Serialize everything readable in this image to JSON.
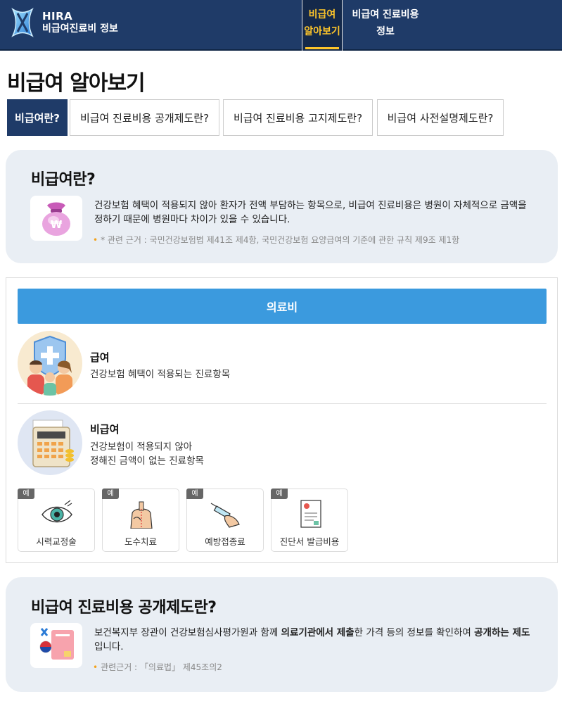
{
  "header": {
    "brand_line1": "HIRA",
    "brand_line2": "비급여진료비 정보",
    "nav": [
      {
        "line1": "비급여",
        "line2": "알아보기"
      },
      {
        "line1": "비급여 진료비용",
        "line2": "정보"
      }
    ],
    "colors": {
      "header_bg": "#1f3b68",
      "active_text": "#ffc62a"
    }
  },
  "page_title": "비급여 알아보기",
  "tabs": [
    {
      "label": "비급여란?",
      "active": true
    },
    {
      "label": "비급여 진료비용 공개제도란?",
      "active": false
    },
    {
      "label": "비급여 진료비용 고지제도란?",
      "active": false
    },
    {
      "label": "비급여 사전설명제도란?",
      "active": false
    }
  ],
  "what_is": {
    "title": "비급여란?",
    "icon": "money-bag-icon",
    "description": "건강보험 혜택이 적용되지 않아 환자가 전액 부담하는 항목으로, 비급여 진료비용은 병원이 자체적으로 금액을 정하기 때문에 병원마다 차이가 있을 수 있습니다.",
    "note": "* 관련 근거 : 국민건강보험법 제41조 제4항, 국민건강보험 요양급여의 기준에 관한 규칙 제9조 제1항"
  },
  "medical_cost": {
    "bar_label": "의료비",
    "bar_color": "#3b9ade",
    "covered": {
      "title": "급여",
      "desc": "건강보험 혜택이 적용되는 진료항목",
      "icon": "family-shield-icon"
    },
    "non_covered": {
      "title": "비급여",
      "desc_line1": "건강보험이 적용되지 않아",
      "desc_line2": "정해진 금액이 없는 진료항목",
      "icon": "calculator-icon"
    },
    "example_badge": "예",
    "examples": [
      {
        "label": "시력교정술",
        "icon": "eye-icon"
      },
      {
        "label": "도수치료",
        "icon": "manual-therapy-icon"
      },
      {
        "label": "예방접종료",
        "icon": "syringe-icon"
      },
      {
        "label": "진단서 발급비용",
        "icon": "certificate-icon"
      }
    ]
  },
  "disclosure": {
    "title": "비급여 진료비용 공개제도란?",
    "icon": "ministry-doc-icon",
    "desc_part1": "보건복지부 장관이 건강보험심사평가원과 함께 ",
    "desc_bold1": "의료기관에서 제출",
    "desc_part2": "한 가격 등의 정보를 확인하여 ",
    "desc_bold2": "공개하는 제도",
    "desc_part3": "입니다.",
    "note": "관련근거 : 「의료법」 제45조의2"
  }
}
